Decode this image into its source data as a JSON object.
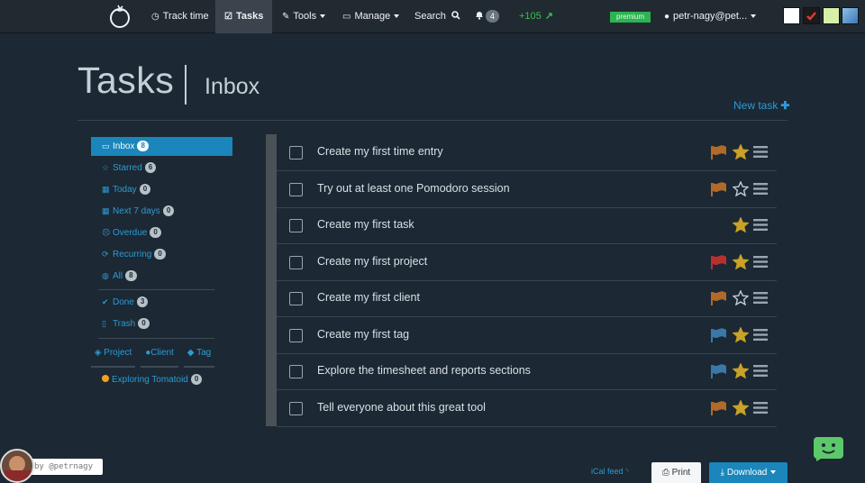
{
  "navbar": {
    "track_time": "Track time",
    "tasks": "Tasks",
    "tools": "Tools",
    "manage": "Manage",
    "search": "Search",
    "notifications_count": "4",
    "points": "+105",
    "plan_badge": "premium",
    "user": "petr-nagy@pet...",
    "theme_swatches": [
      "#ffffff",
      "#1b1b1b",
      "#d8efa8",
      "#5a9ad0"
    ]
  },
  "header": {
    "title": "Tasks",
    "subtitle": "Inbox",
    "new_task": "New task"
  },
  "sidebar": {
    "items": [
      {
        "label": "Inbox",
        "count": "8",
        "icon": "inbox-icon"
      },
      {
        "label": "Starred",
        "count": "6",
        "icon": "star-icon"
      },
      {
        "label": "Today",
        "count": "0",
        "icon": "calendar-icon"
      },
      {
        "label": "Next 7 days",
        "count": "0",
        "icon": "calendar-week-icon"
      },
      {
        "label": "Overdue",
        "count": "0",
        "icon": "frown-icon"
      },
      {
        "label": "Recurring",
        "count": "0",
        "icon": "refresh-icon"
      },
      {
        "label": "All",
        "count": "8",
        "icon": "globe-icon"
      },
      {
        "label": "Done",
        "count": "3",
        "icon": "check-icon"
      },
      {
        "label": "Trash",
        "count": "0",
        "icon": "trash-icon"
      }
    ],
    "filter_tabs": [
      "Project",
      "Client",
      "Tag"
    ],
    "project": {
      "label": "Exploring Tomatoid",
      "count": "0",
      "color": "#f0a020"
    }
  },
  "tasks": [
    {
      "label": "Create my first time entry",
      "flag": "#b06a2a",
      "starred": true
    },
    {
      "label": "Try out at least one Pomodoro session",
      "flag": "#b06a2a",
      "starred": false
    },
    {
      "label": "Create my first task",
      "flag": "",
      "starred": true
    },
    {
      "label": "Create my first project",
      "flag": "#b8302e",
      "starred": true
    },
    {
      "label": "Create my first client",
      "flag": "#b06a2a",
      "starred": false
    },
    {
      "label": "Create my first tag",
      "flag": "#3a78a8",
      "starred": true
    },
    {
      "label": "Explore the timesheet and reports sections",
      "flag": "#3a78a8",
      "starred": true
    },
    {
      "label": "Tell everyone about this great tool",
      "flag": "#b06a2a",
      "starred": true
    }
  ],
  "footer": {
    "ical": "iCal feed",
    "print": "Print",
    "download": "Download",
    "byline": "by @petrnagy"
  },
  "colors": {
    "background": "#1c2833",
    "accent": "#1a86bb",
    "link": "#2c9bd6",
    "star": "#c9a227",
    "chat": "#5cc86a"
  }
}
